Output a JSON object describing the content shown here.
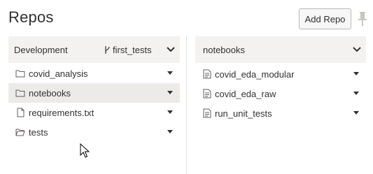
{
  "header": {
    "title": "Repos",
    "add_repo_label": "Add Repo"
  },
  "left_panel": {
    "header_label": "Development",
    "branch": "first_tests",
    "items": [
      {
        "label": "covid_analysis",
        "icon": "folder-icon",
        "selected": false
      },
      {
        "label": "notebooks",
        "icon": "folder-icon",
        "selected": true
      },
      {
        "label": "requirements.txt",
        "icon": "file-icon",
        "selected": false
      },
      {
        "label": "tests",
        "icon": "folder-open-icon",
        "selected": false
      }
    ]
  },
  "right_panel": {
    "header_label": "notebooks",
    "items": [
      {
        "label": "covid_eda_modular",
        "icon": "notebook-icon"
      },
      {
        "label": "covid_eda_raw",
        "icon": "notebook-icon"
      },
      {
        "label": "run_unit_tests",
        "icon": "notebook-icon"
      }
    ]
  },
  "colors": {
    "panel_header_bg": "#f3f2f1",
    "selected_row_bg": "#edebe9",
    "text": "#323130"
  }
}
